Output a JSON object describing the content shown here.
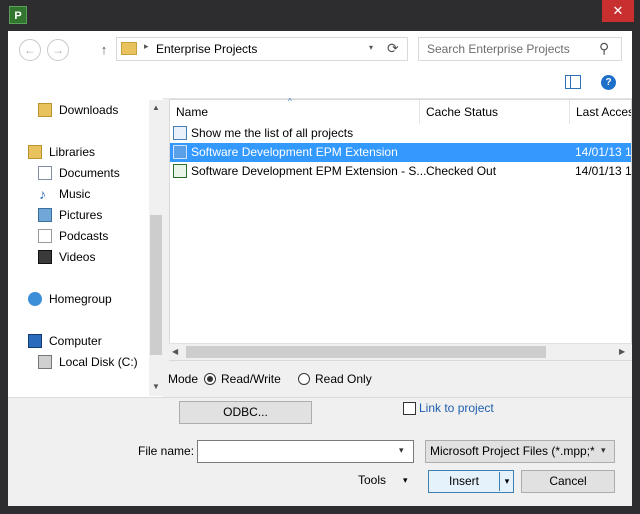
{
  "window": {
    "app_icon_label": "P",
    "close_glyph": "✕"
  },
  "nav": {
    "back_glyph": "←",
    "forward_glyph": "→",
    "up_glyph": "↑",
    "breadcrumb_sep": "▸",
    "breadcrumb": "Enterprise Projects",
    "refresh_glyph": "⟳",
    "search_placeholder": "Search Enterprise Projects",
    "search_glyph": "⚲"
  },
  "sidebar": {
    "items": [
      {
        "label": "Downloads",
        "icon": "downloads-icon"
      },
      {
        "label": "Libraries",
        "icon": "libraries-icon"
      },
      {
        "label": "Documents",
        "icon": "documents-icon"
      },
      {
        "label": "Music",
        "icon": "music-icon"
      },
      {
        "label": "Pictures",
        "icon": "pictures-icon"
      },
      {
        "label": "Podcasts",
        "icon": "podcasts-icon"
      },
      {
        "label": "Videos",
        "icon": "videos-icon"
      },
      {
        "label": "Homegroup",
        "icon": "homegroup-icon"
      },
      {
        "label": "Computer",
        "icon": "computer-icon"
      },
      {
        "label": "Local Disk (C:)",
        "icon": "disk-icon"
      }
    ]
  },
  "list": {
    "columns": [
      "Name",
      "Cache Status",
      "Last Accessed"
    ],
    "rows": [
      {
        "name": "Show me the list of all projects",
        "status": "",
        "date": ""
      },
      {
        "name": "Software Development EPM Extension",
        "status": "",
        "date": "14/01/13 1"
      },
      {
        "name": "Software Development EPM Extension - S...",
        "status": "Checked Out",
        "date": "14/01/13 1"
      }
    ]
  },
  "mode": {
    "label": "Mode",
    "option_rw": "Read/Write",
    "option_ro": "Read Only",
    "selected": "Read/Write"
  },
  "odbc_button": "ODBC...",
  "link_to_project": "Link to project",
  "file_name_label": "File name:",
  "file_name_value": "",
  "file_type": "Microsoft Project Files (*.mpp;*",
  "tools_label": "Tools",
  "insert_label": "Insert",
  "cancel_label": "Cancel",
  "colors": {
    "selection": "#3399ff",
    "frame": "#2d2d30",
    "close": "#c7302f"
  }
}
